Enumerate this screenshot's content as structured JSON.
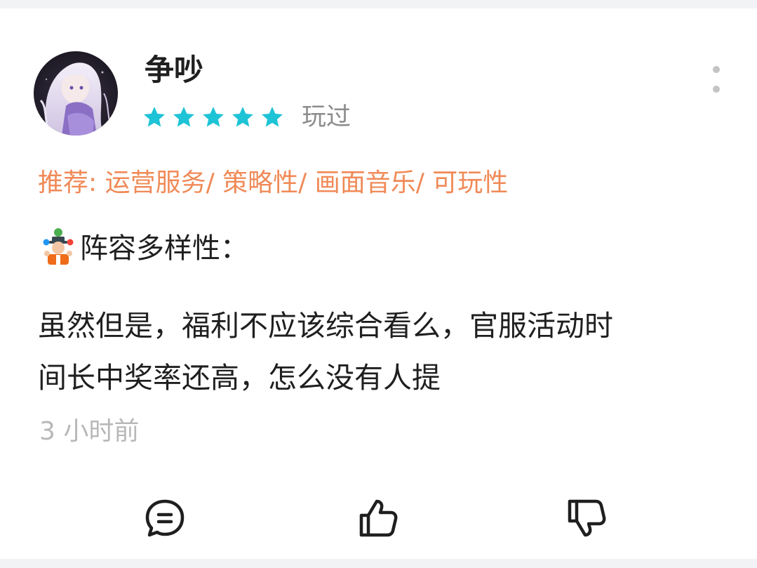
{
  "review": {
    "username": "争吵",
    "rating": 5,
    "rating_max": 5,
    "played_label": "玩过",
    "recommend": "推荐: 运营服务/ 策略性/ 画面音乐/ 可玩性",
    "section_heading": "阵容多样性：",
    "content_lines": [
      "虽然但是，福利不应该综合看么，官服活动时",
      "间长中奖率还高，怎么没有人提"
    ],
    "time": "3 小时前"
  },
  "colors": {
    "star": "#1ec3d6",
    "recommend": "#f08a57",
    "time": "#b8b8b8",
    "text": "#1f1f1f"
  },
  "icons": {
    "more": "more-vertical-icon",
    "comment": "comment-bubble-icon",
    "like": "thumbs-up-icon",
    "dislike": "thumbs-down-icon",
    "section_emoji": "juggler-emoji-icon"
  }
}
